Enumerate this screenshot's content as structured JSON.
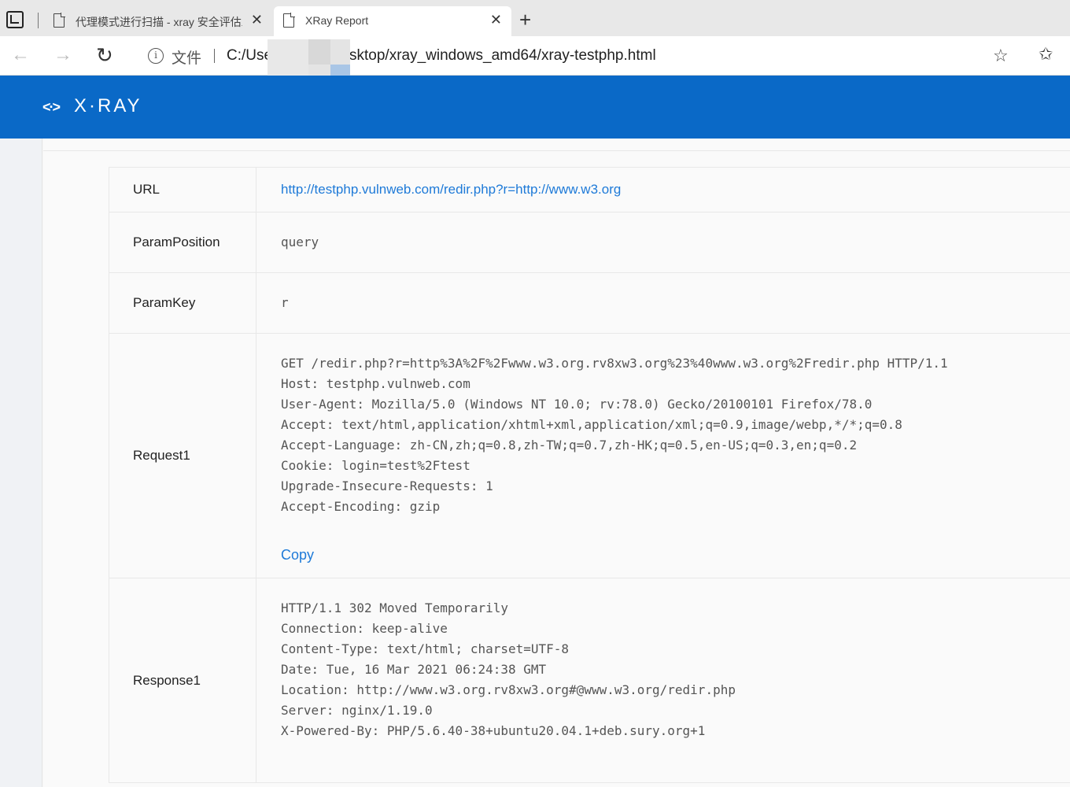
{
  "browser": {
    "tabs": [
      {
        "title": "代理模式进行扫描 - xray 安全评估工具",
        "active": false
      },
      {
        "title": "XRay Report",
        "active": true
      }
    ],
    "address": {
      "scheme_label": "文件",
      "url_visible_start": "C:/Use",
      "url_visible_end": "sktop/xray_windows_amd64/xray-testphp.html"
    }
  },
  "header": {
    "logo_mark": "<·>",
    "logo_text": "X·RAY",
    "bg_color": "#0a69c7"
  },
  "details": {
    "url_label": "URL",
    "url_value": "http://testphp.vulnweb.com/redir.php?r=http://www.w3.org",
    "param_position_label": "ParamPosition",
    "param_position_value": "query",
    "param_key_label": "ParamKey",
    "param_key_value": "r",
    "request_label": "Request1",
    "request_lines": [
      "GET /redir.php?r=http%3A%2F%2Fwww.w3.org.rv8xw3.org%23%40www.w3.org%2Fredir.php HTTP/1.1",
      "Host: testphp.vulnweb.com",
      "User-Agent: Mozilla/5.0 (Windows NT 10.0; rv:78.0) Gecko/20100101 Firefox/78.0",
      "Accept: text/html,application/xhtml+xml,application/xml;q=0.9,image/webp,*/*;q=0.8",
      "Accept-Language: zh-CN,zh;q=0.8,zh-TW;q=0.7,zh-HK;q=0.5,en-US;q=0.3,en;q=0.2",
      "Cookie: login=test%2Ftest",
      "Upgrade-Insecure-Requests: 1",
      "Accept-Encoding: gzip"
    ],
    "copy_label": "Copy",
    "response_label": "Response1",
    "response_lines": [
      "HTTP/1.1 302 Moved Temporarily",
      "Connection: keep-alive",
      "Content-Type: text/html; charset=UTF-8",
      "Date: Tue, 16 Mar 2021 06:24:38 GMT",
      "Location: http://www.w3.org.rv8xw3.org#@www.w3.org/redir.php",
      "Server: nginx/1.19.0",
      "X-Powered-By: PHP/5.6.40-38+ubuntu20.04.1+deb.sury.org+1"
    ]
  }
}
